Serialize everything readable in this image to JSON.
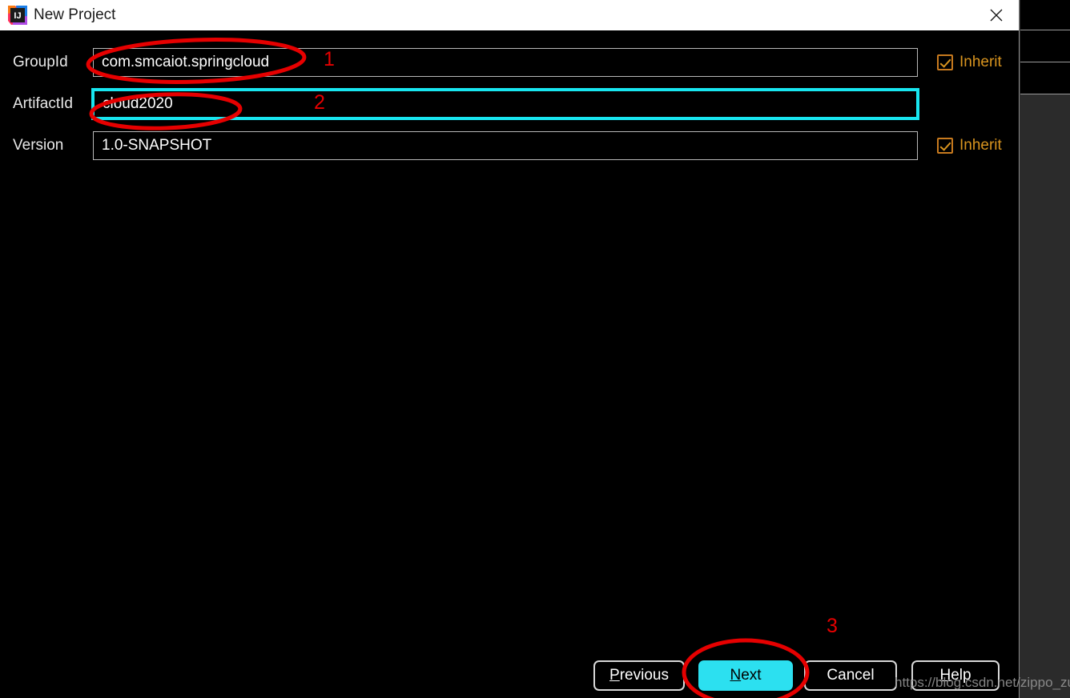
{
  "window": {
    "title": "New Project",
    "app_icon": "intellij-idea-icon",
    "close_icon": "close-icon"
  },
  "form": {
    "fields": [
      {
        "label": "GroupId",
        "value": "com.smcaiot.springcloud",
        "inherit_label": "Inherit",
        "inherit_checked": true,
        "highlighted": false
      },
      {
        "label": "ArtifactId",
        "value": "cloud2020",
        "inherit_label": "",
        "inherit_checked": false,
        "highlighted": true
      },
      {
        "label": "Version",
        "value": "1.0-SNAPSHOT",
        "inherit_label": "Inherit",
        "inherit_checked": true,
        "highlighted": false
      }
    ]
  },
  "buttons": {
    "previous": {
      "label": "Previous",
      "mnemonic": "P",
      "rest": "revious"
    },
    "next": {
      "label": "Next",
      "mnemonic": "N",
      "rest": "ext"
    },
    "cancel": {
      "label": "Cancel",
      "mnemonic": "",
      "rest": "Cancel"
    },
    "help": {
      "label": "Help",
      "mnemonic": "H",
      "rest": "elp"
    }
  },
  "annotations": {
    "marker_1": "1",
    "marker_2": "2",
    "marker_3": "3",
    "highlight_color": "#2ce0f0",
    "marker_color": "#e60000"
  },
  "watermark": {
    "text": "https://blog.csdn.net/zippo_zu"
  }
}
